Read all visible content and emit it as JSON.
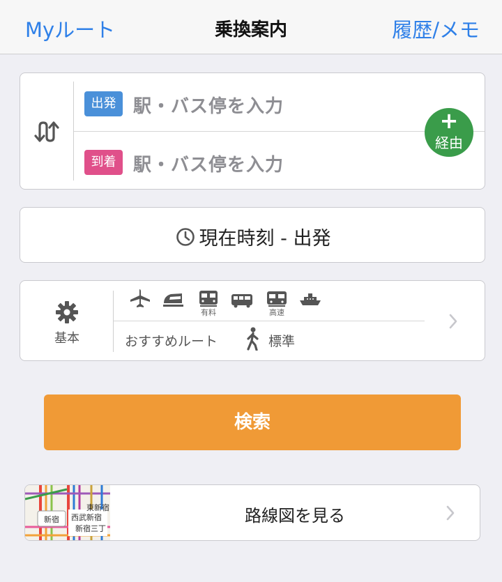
{
  "navbar": {
    "left_label": "Myルート",
    "title": "乗換案内",
    "right_label": "履歴/メモ"
  },
  "stations": {
    "from_tag": "出発",
    "from_placeholder": "駅・バス停を入力",
    "to_tag": "到着",
    "to_placeholder": "駅・バス停を入力",
    "via_label": "経由",
    "via_plus": "+"
  },
  "time": {
    "label": "現在時刻 - 出発"
  },
  "settings": {
    "label": "基本",
    "modes": [
      {
        "icon": "airplane-icon",
        "caption": ""
      },
      {
        "icon": "shinkansen-icon",
        "caption": ""
      },
      {
        "icon": "paid-express-train-icon",
        "caption": "有料"
      },
      {
        "icon": "bus-icon",
        "caption": ""
      },
      {
        "icon": "highway-bus-icon",
        "caption": "高速"
      },
      {
        "icon": "ferry-icon",
        "caption": ""
      }
    ],
    "route_preference": "おすすめルート",
    "walk_speed": "標準"
  },
  "search_button": "検索",
  "route_map": {
    "label": "路線図を見る",
    "thumb_labels": [
      "新宿",
      "西武新宿",
      "東新宿",
      "新宿三丁"
    ]
  },
  "colors": {
    "accent_blue": "#2f80e8",
    "from_tag": "#4a90d9",
    "to_tag": "#e0508a",
    "via_green": "#3a9c4a",
    "search_orange": "#f09a36"
  }
}
